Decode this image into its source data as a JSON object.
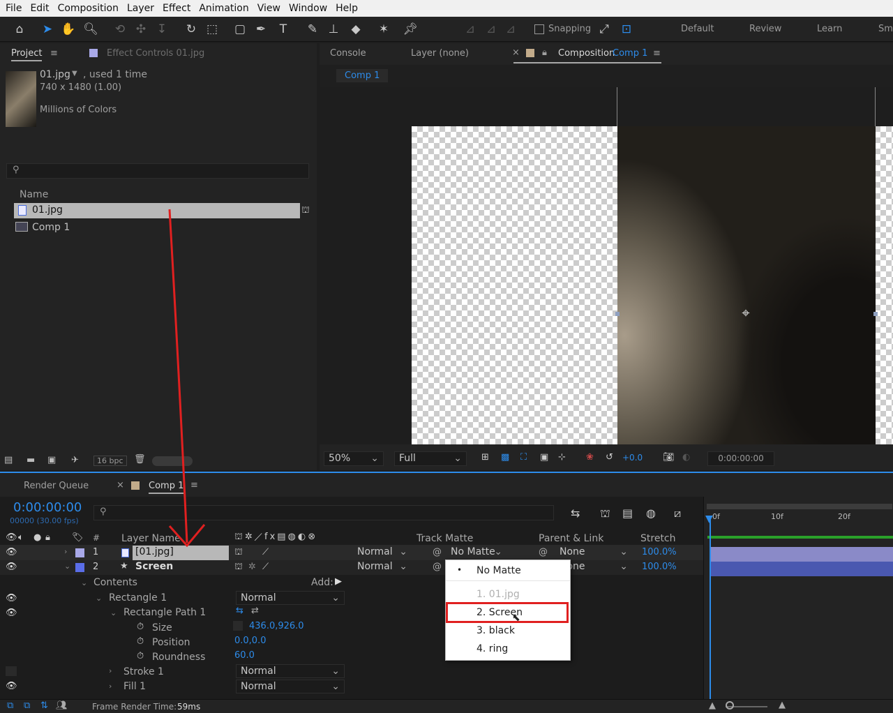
{
  "menu": [
    "File",
    "Edit",
    "Composition",
    "Layer",
    "Effect",
    "Animation",
    "View",
    "Window",
    "Help"
  ],
  "toolbar": {
    "snapping": "Snapping",
    "workspaces": [
      "Default",
      "Review",
      "Learn",
      "Sm"
    ]
  },
  "project": {
    "tab": "Project",
    "effect_tab": "Effect Controls 01.jpg",
    "item_name": "01.jpg",
    "item_used": ", used 1 time",
    "item_dims": "740 x 1480 (1.00)",
    "item_colors": "Millions of Colors",
    "search_placeholder": "",
    "col_name": "Name",
    "items": [
      "01.jpg",
      "Comp 1"
    ],
    "bpc": "16 bpc"
  },
  "viewer": {
    "tabs": {
      "console": "Console",
      "layer": "Layer (none)",
      "comp_prefix": "Composition",
      "comp_name": "Comp 1"
    },
    "breadcrumb": "Comp 1",
    "zoom": "50%",
    "resolution": "Full",
    "exposure": "+0.0",
    "timecode": "0:00:00:00"
  },
  "timeline": {
    "tabs": {
      "render": "Render Queue",
      "comp": "Comp 1"
    },
    "timecode": "0:00:00:00",
    "fps": "00000 (30.00 fps)",
    "headers": {
      "num": "#",
      "layer_name": "Layer Name",
      "track_matte": "Track Matte",
      "parent": "Parent & Link",
      "stretch": "Stretch"
    },
    "ruler": [
      "0f",
      "10f",
      "20f"
    ],
    "layers": [
      {
        "num": "1",
        "name": "[01.jpg]",
        "mode": "Normal",
        "matte": "No Matte",
        "parent": "None",
        "stretch": "100.0%"
      },
      {
        "num": "2",
        "name": "Screen",
        "mode": "Normal",
        "parent": "None",
        "stretch": "100.0%"
      }
    ],
    "props": {
      "contents": "Contents",
      "add": "Add:",
      "rect": "Rectangle 1",
      "rect_mode": "Normal",
      "path": "Rectangle Path 1",
      "size_label": "Size",
      "size_value": "436.0,926.0",
      "pos_label": "Position",
      "pos_value": "0.0,0.0",
      "round_label": "Roundness",
      "round_value": "60.0",
      "stroke": "Stroke 1",
      "stroke_mode": "Normal",
      "fill": "Fill 1",
      "fill_mode": "Normal"
    },
    "frame_render": "Frame Render Time:",
    "frame_render_value": "59ms"
  },
  "dropdown": {
    "items": [
      "No Matte",
      "1. 01.jpg",
      "2. Screen",
      "3. black",
      "4. ring"
    ]
  },
  "colors": {
    "accent": "#2d8ceb",
    "highlight": "#e02020",
    "label_lavender": "#a9a9e8",
    "label_blue": "#5a6de8"
  }
}
